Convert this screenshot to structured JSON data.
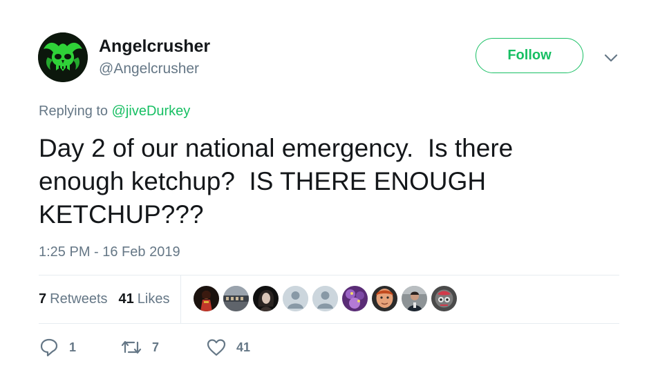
{
  "user": {
    "display_name": "Angelcrusher",
    "handle": "@Angelcrusher",
    "avatar_icon": "green-skull-avatar"
  },
  "follow_button": {
    "label": "Follow"
  },
  "menu_icon": "chevron-down-icon",
  "reply": {
    "prefix": "Replying to ",
    "mention": "@jiveDurkey"
  },
  "tweet": {
    "lines": [
      "Day 2 of our national emergency.  Is there",
      "enough ketchup?  IS THERE ENOUGH",
      "KETCHUP???"
    ]
  },
  "timestamp": "1:25 PM - 16 Feb 2019",
  "stats": {
    "retweets_count": "7",
    "retweets_label": "Retweets",
    "likes_count": "41",
    "likes_label": "Likes"
  },
  "liked_by_avatars": 9,
  "actions": {
    "reply_count": "1",
    "retweet_count": "7",
    "like_count": "41"
  },
  "colors": {
    "accent": "#17bf63",
    "text_primary": "#14171a",
    "text_secondary": "#657786",
    "divider": "#e6ecf0"
  }
}
